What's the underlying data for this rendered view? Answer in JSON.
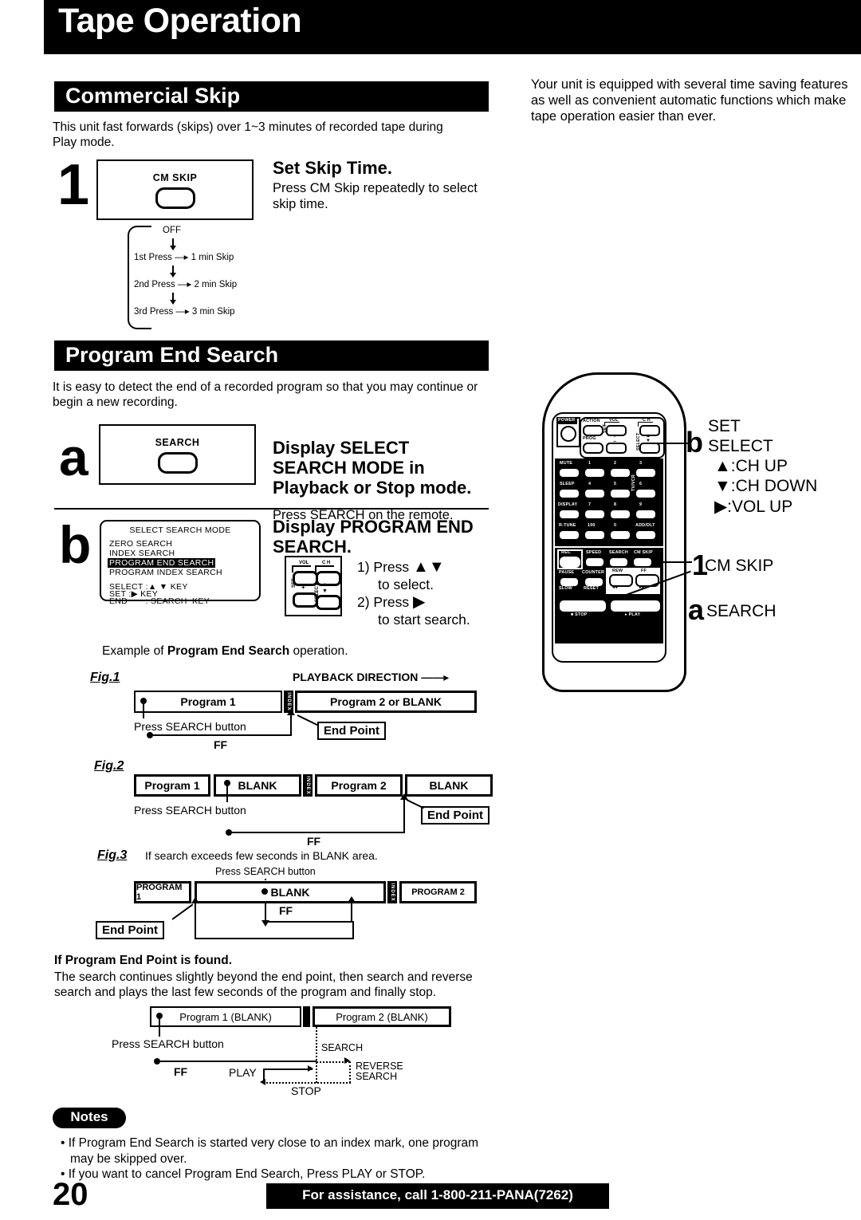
{
  "page": {
    "title": "Tape Operation",
    "page_number": "20",
    "footer": "For assistance, call 1-800-211-PANA(7262)"
  },
  "intro": {
    "paragraph": "Your unit is equipped with several time saving features as well as convenient automatic functions which make tape operation easier than ever."
  },
  "commercial_skip": {
    "heading": "Commercial Skip",
    "description": "This unit fast forwards (skips) over 1~3 minutes of recorded tape during Play mode.",
    "step_number": "1",
    "button_label": "CM SKIP",
    "step_title": "Set Skip Time.",
    "step_text": "Press CM Skip repeatedly to select skip time.",
    "flow": {
      "start": "OFF",
      "rows": [
        {
          "press": "1st  Press",
          "result": "1 min Skip"
        },
        {
          "press": "2nd Press",
          "result": "2 min Skip"
        },
        {
          "press": "3rd  Press",
          "result": "3 min Skip"
        }
      ]
    }
  },
  "program_end_search": {
    "heading": "Program End Search",
    "description": "It is easy to detect the end of a recorded program so that you may continue or begin a new recording.",
    "step_a": {
      "letter": "a",
      "button_label": "SEARCH",
      "title_line1": "Display SELECT",
      "title_line2": "SEARCH MODE in",
      "title_line3": "Playback or Stop mode.",
      "text": "Press SEARCH on the remote."
    },
    "step_b": {
      "letter": "b",
      "title_line1": "Display PROGRAM END",
      "title_line2": "SEARCH.",
      "instructions": [
        {
          "num": "1) Press",
          "glyph": "▲▼",
          "cont": "to select."
        },
        {
          "num": "2) Press",
          "glyph": "▶",
          "cont": "to start search."
        }
      ],
      "osd": {
        "title": "SELECT SEARCH MODE",
        "items": [
          {
            "label": "ZERO  SEARCH",
            "selected": false
          },
          {
            "label": "INDEX  SEARCH",
            "selected": false
          },
          {
            "label": "PROGRAM  END  SEARCH",
            "selected": true
          },
          {
            "label": "PROGRAM  INDEX  SEARCH",
            "selected": false
          }
        ],
        "keys": [
          "SELECT :▲ ▼ KEY",
          "SET       :▶ KEY",
          "END       : SEARCH  KEY"
        ]
      },
      "mini_panel": {
        "vol": "VOL",
        "ch": "C H",
        "set": "SET",
        "select": "SELECT",
        "plus": "+",
        "minus": "−"
      }
    },
    "example_caption": "Example of Program End Search operation."
  },
  "figures": {
    "fig1": {
      "label": "Fig.1",
      "direction_label": "PLAYBACK DIRECTION",
      "segments": [
        "Program 1",
        "Program 2 or BLANK"
      ],
      "index_label": "INDEX",
      "press_label": "Press SEARCH button",
      "ff_label": "FF",
      "end_point": "End Point"
    },
    "fig2": {
      "label": "Fig.2",
      "segments": [
        "Program 1",
        "BLANK",
        "Program 2",
        "BLANK"
      ],
      "index_label": "INDEX",
      "press_label": "Press SEARCH button",
      "ff_label": "FF",
      "end_point": "End Point"
    },
    "fig3": {
      "label": "Fig.3",
      "caption": "If search exceeds few seconds in BLANK area.",
      "segments": [
        "PROGRAM 1",
        "BLANK",
        "PROGRAM 2"
      ],
      "index_label": "INDEX",
      "press_label": "Press SEARCH button",
      "ff_label": "FF",
      "end_point": "End Point"
    },
    "found": {
      "heading": "If Program End Point is found.",
      "description": "The search continues slightly beyond the end point, then search and reverse search and plays the last few seconds of the program and finally stop.",
      "segments": [
        "Program 1 (BLANK)",
        "Program 2 (BLANK)"
      ],
      "press_label": "Press SEARCH button",
      "ff_label": "FF",
      "play_label": "PLAY",
      "search_label": "SEARCH",
      "reverse_label_line1": "REVERSE",
      "reverse_label_line2": "SEARCH",
      "stop_label": "STOP"
    }
  },
  "notes": {
    "badge": "Notes",
    "items": [
      "If Program End Search is started very close to an index mark, one program may be skipped over.",
      "If you want to cancel Program End Search, Press PLAY or STOP."
    ]
  },
  "remote": {
    "buttons": {
      "power": "POWER",
      "action": "ACTION",
      "vol": "VOL",
      "ch": "C H",
      "prog": "PROG",
      "set": "SET",
      "select": "SELECT",
      "plus": "+",
      "minus": "−",
      "mute": "MUTE",
      "sleep": "SLEEP",
      "display": "DISPLAY",
      "r_tune": "R-TUNE",
      "num1": "1",
      "num2": "2",
      "num3": "3",
      "num4": "4",
      "num5": "5",
      "num6": "6",
      "num7": "7",
      "num8": "8",
      "num9": "9",
      "num100": "100",
      "num0": "0",
      "add_dlt": "ADD/DLT",
      "tv_vcr": "TV/VCR",
      "rec": "REC",
      "speed": "SPEED",
      "search": "SEARCH",
      "cm_skip": "CM SKIP",
      "pause": "PAUSE",
      "counter": "COUNTER",
      "slow": "SLOW",
      "reset": "RESET",
      "rew": "REW",
      "ff": "FF",
      "stop": "STOP",
      "play": "PLAY"
    },
    "callouts": {
      "b_glyph": "b",
      "b_line1": "SET",
      "b_line2": "SELECT",
      "b_line3": "▲:CH UP",
      "b_line4": "▼:CH DOWN",
      "b_line5": "▶:VOL UP",
      "one_glyph": "1",
      "one_label": "CM SKIP",
      "a_glyph": "a",
      "a_label": "SEARCH"
    }
  }
}
